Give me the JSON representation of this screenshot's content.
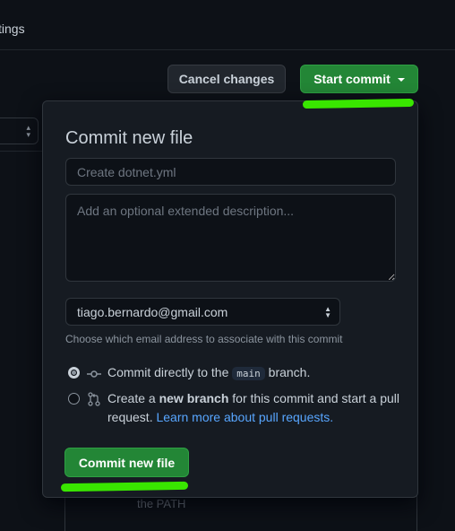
{
  "topbar": {
    "label": "tings"
  },
  "left_select": {
    "arrows": "⇕"
  },
  "actions": {
    "cancel_label": "Cancel changes",
    "start_label": "Start commit"
  },
  "background": {
    "text": "the PATH"
  },
  "dialog": {
    "title": "Commit new file",
    "summary_placeholder": "Create dotnet.yml",
    "description_placeholder": "Add an optional extended description...",
    "email_value": "tiago.bernardo@gmail.com",
    "email_note": "Choose which email address to associate with this commit",
    "option_direct": {
      "before": "Commit directly to the ",
      "branch": "main",
      "after": " branch.",
      "selected": true
    },
    "option_new_branch": {
      "before": "Create a ",
      "bold": "new branch",
      "after": " for this commit and start a pull request. ",
      "link": "Learn more about pull requests.",
      "selected": false
    },
    "submit_label": "Commit new file"
  },
  "colors": {
    "primary_green": "#238636",
    "highlight_green": "#39e600",
    "link_blue": "#58a6ff",
    "background": "#0d1117"
  },
  "icons": [
    "select-arrows-icon",
    "caret-down-icon",
    "git-commit-icon",
    "git-pull-request-icon"
  ]
}
